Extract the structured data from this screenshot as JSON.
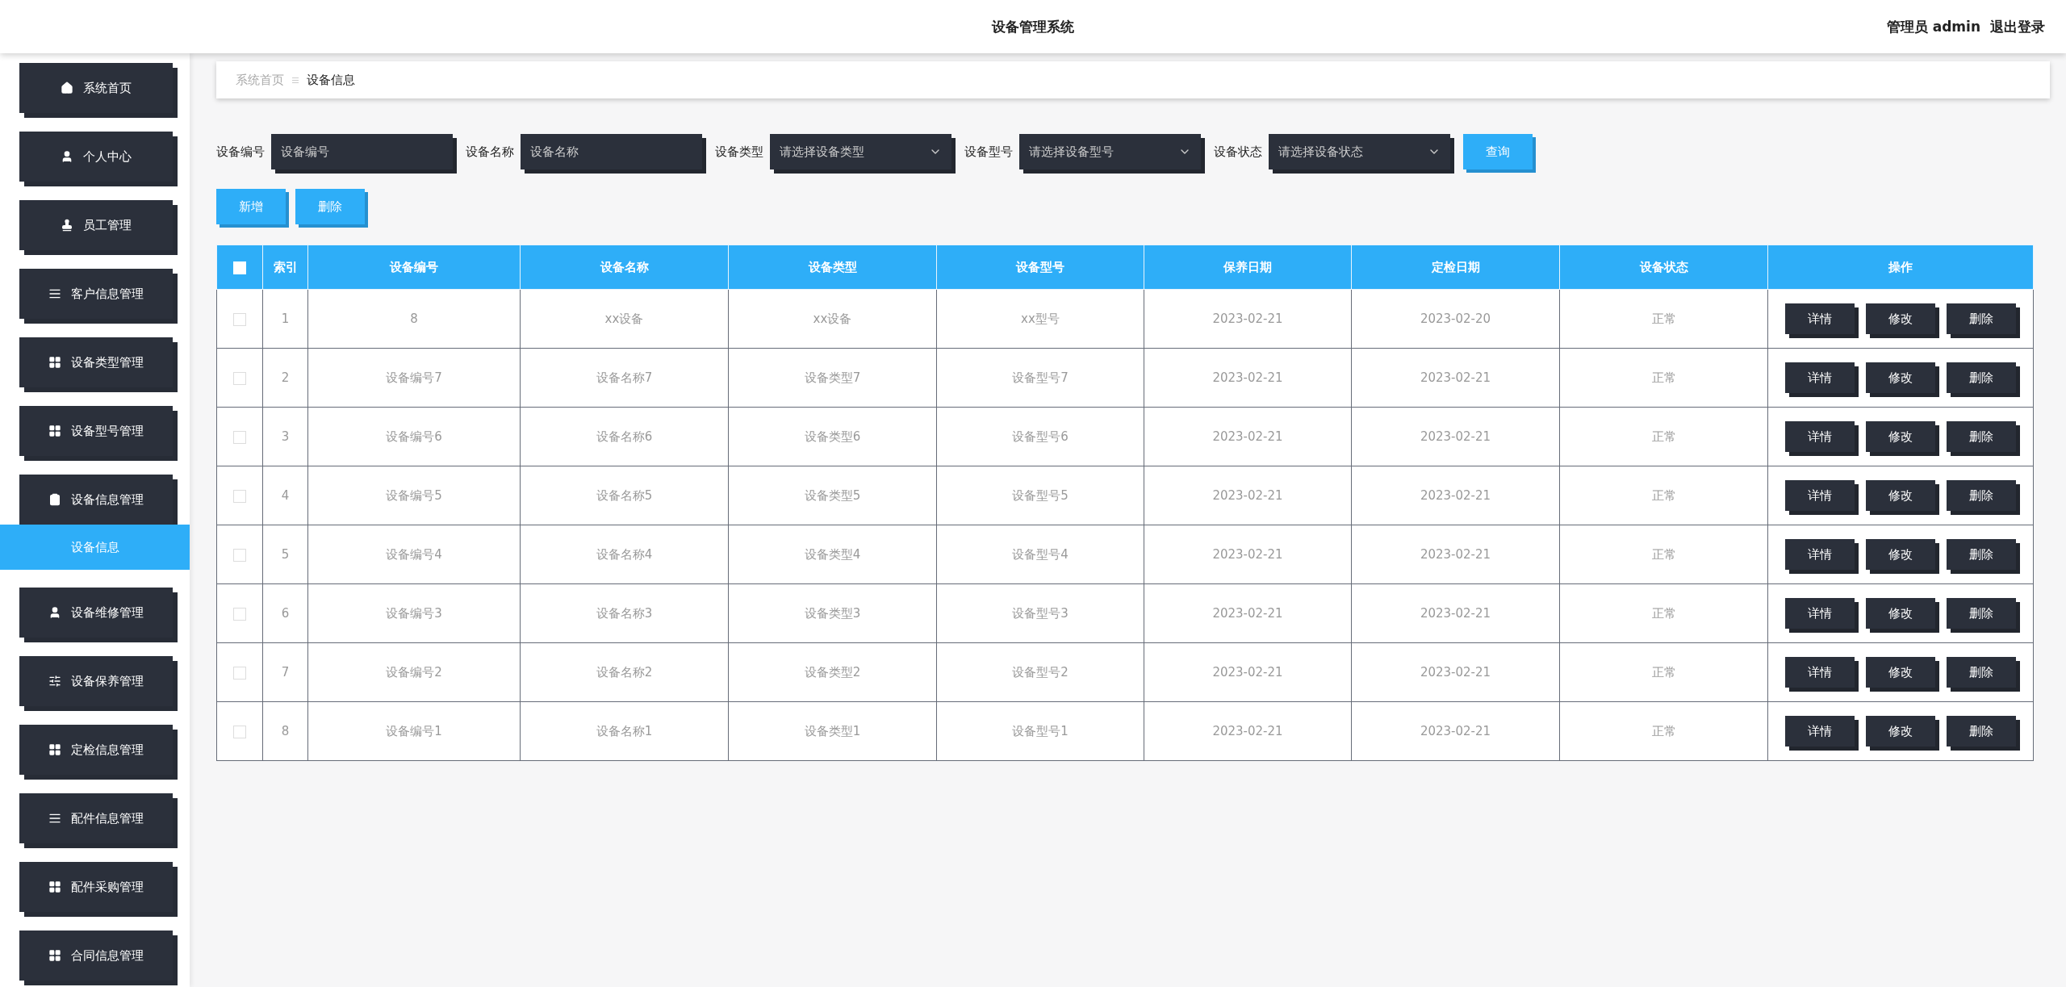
{
  "header": {
    "title": "设备管理系统",
    "user": "管理员 admin",
    "logout": "退出登录"
  },
  "sidebar": {
    "items": [
      {
        "label": "系统首页",
        "expanded": false
      },
      {
        "label": "个人中心",
        "expanded": false
      },
      {
        "label": "员工管理",
        "expanded": false
      },
      {
        "label": "客户信息管理",
        "expanded": false
      },
      {
        "label": "设备类型管理",
        "expanded": false
      },
      {
        "label": "设备型号管理",
        "expanded": false
      },
      {
        "label": "设备信息管理",
        "expanded": true,
        "children": [
          {
            "label": "设备信息",
            "selected": true
          }
        ]
      },
      {
        "label": "设备维修管理",
        "expanded": false
      },
      {
        "label": "设备保养管理",
        "expanded": false
      },
      {
        "label": "定检信息管理",
        "expanded": false
      },
      {
        "label": "配件信息管理",
        "expanded": false
      },
      {
        "label": "配件采购管理",
        "expanded": false
      },
      {
        "label": "合同信息管理",
        "expanded": false
      }
    ]
  },
  "breadcrumb": [
    "系统首页",
    "设备信息"
  ],
  "filters": [
    {
      "kind": "input",
      "label": "设备编号",
      "placeholder": "设备编号"
    },
    {
      "kind": "input",
      "label": "设备名称",
      "placeholder": "设备名称"
    },
    {
      "kind": "select",
      "label": "设备类型",
      "placeholder": "请选择设备类型"
    },
    {
      "kind": "select",
      "label": "设备型号",
      "placeholder": "请选择设备型号"
    },
    {
      "kind": "select",
      "label": "设备状态",
      "placeholder": "请选择设备状态"
    }
  ],
  "search_button": "查询",
  "actions": [
    "新增",
    "删除"
  ],
  "table": {
    "select_all": {
      "checked": false
    },
    "columns": [
      "索引",
      "设备编号",
      "设备名称",
      "设备类型",
      "设备型号",
      "保养日期",
      "定检日期",
      "设备状态",
      "操作"
    ],
    "rows": [
      {
        "checked": false,
        "cells": [
          "1",
          "8",
          "xx设备",
          "xx设备",
          "xx型号",
          "2023-02-21",
          "2023-02-20",
          "正常"
        ],
        "actions": [
          "详情",
          "修改",
          "删除"
        ]
      },
      {
        "checked": false,
        "cells": [
          "2",
          "设备编号7",
          "设备名称7",
          "设备类型7",
          "设备型号7",
          "2023-02-21",
          "2023-02-21",
          "正常"
        ],
        "actions": [
          "详情",
          "修改",
          "删除"
        ]
      },
      {
        "checked": false,
        "cells": [
          "3",
          "设备编号6",
          "设备名称6",
          "设备类型6",
          "设备型号6",
          "2023-02-21",
          "2023-02-21",
          "正常"
        ],
        "actions": [
          "详情",
          "修改",
          "删除"
        ]
      },
      {
        "checked": false,
        "cells": [
          "4",
          "设备编号5",
          "设备名称5",
          "设备类型5",
          "设备型号5",
          "2023-02-21",
          "2023-02-21",
          "正常"
        ],
        "actions": [
          "详情",
          "修改",
          "删除"
        ]
      },
      {
        "checked": false,
        "cells": [
          "5",
          "设备编号4",
          "设备名称4",
          "设备类型4",
          "设备型号4",
          "2023-02-21",
          "2023-02-21",
          "正常"
        ],
        "actions": [
          "详情",
          "修改",
          "删除"
        ]
      },
      {
        "checked": false,
        "cells": [
          "6",
          "设备编号3",
          "设备名称3",
          "设备类型3",
          "设备型号3",
          "2023-02-21",
          "2023-02-21",
          "正常"
        ],
        "actions": [
          "详情",
          "修改",
          "删除"
        ]
      },
      {
        "checked": false,
        "cells": [
          "7",
          "设备编号2",
          "设备名称2",
          "设备类型2",
          "设备型号2",
          "2023-02-21",
          "2023-02-21",
          "正常"
        ],
        "actions": [
          "详情",
          "修改",
          "删除"
        ]
      },
      {
        "checked": false,
        "cells": [
          "8",
          "设备编号1",
          "设备名称1",
          "设备类型1",
          "设备型号1",
          "2023-02-21",
          "2023-02-21",
          "正常"
        ],
        "actions": [
          "详情",
          "修改",
          "删除"
        ]
      }
    ]
  }
}
